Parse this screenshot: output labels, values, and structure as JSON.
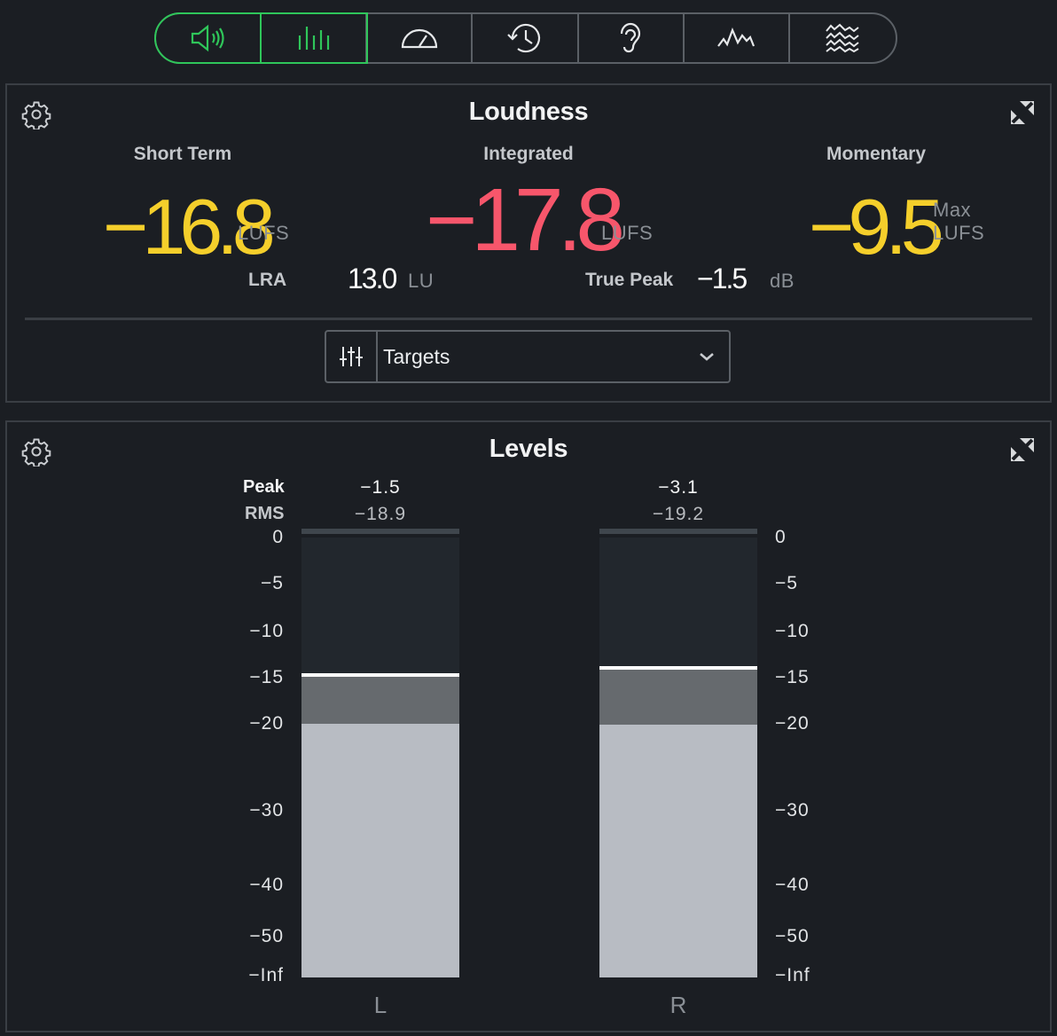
{
  "toolbar": {
    "buttons": [
      {
        "icon": "speaker-icon",
        "active": true
      },
      {
        "icon": "bars-icon",
        "active": true
      },
      {
        "icon": "meter-gauge-icon",
        "active": false
      },
      {
        "icon": "history-icon",
        "active": false
      },
      {
        "icon": "ear-icon",
        "active": false
      },
      {
        "icon": "spectrum-peaks-icon",
        "active": false
      },
      {
        "icon": "spectrogram-icon",
        "active": false
      }
    ],
    "accent_color": "#2fc65a"
  },
  "loudness": {
    "title": "Loudness",
    "short_term": {
      "label": "Short Term",
      "value": "−16.8",
      "unit": "LUFS"
    },
    "integrated": {
      "label": "Integrated",
      "value": "−17.8",
      "unit": "LUFS"
    },
    "momentary": {
      "label": "Momentary",
      "value": "−9.5",
      "unit_line1": "Max",
      "unit_line2": "LUFS"
    },
    "lra": {
      "label": "LRA",
      "value": "13.0",
      "unit": "LU"
    },
    "true_peak": {
      "label": "True Peak",
      "value": "−1.5",
      "unit": "dB"
    },
    "targets": {
      "label": "Targets"
    },
    "colors": {
      "yellow": "#f5cf2b",
      "red": "#f7566b"
    }
  },
  "levels": {
    "title": "Levels",
    "peak_label": "Peak",
    "rms_label": "RMS",
    "channels": [
      {
        "label": "L",
        "peak": "−1.5",
        "rms": "−18.9",
        "peak_hold_db": -14.7,
        "rms_db": -20.0
      },
      {
        "label": "R",
        "peak": "−3.1",
        "rms": "−19.2",
        "peak_hold_db": -13.9,
        "rms_db": -20.1
      }
    ],
    "scale": [
      "0",
      "−5",
      "−10",
      "−15",
      "−20",
      "−30",
      "−40",
      "−50",
      "−Inf"
    ]
  }
}
